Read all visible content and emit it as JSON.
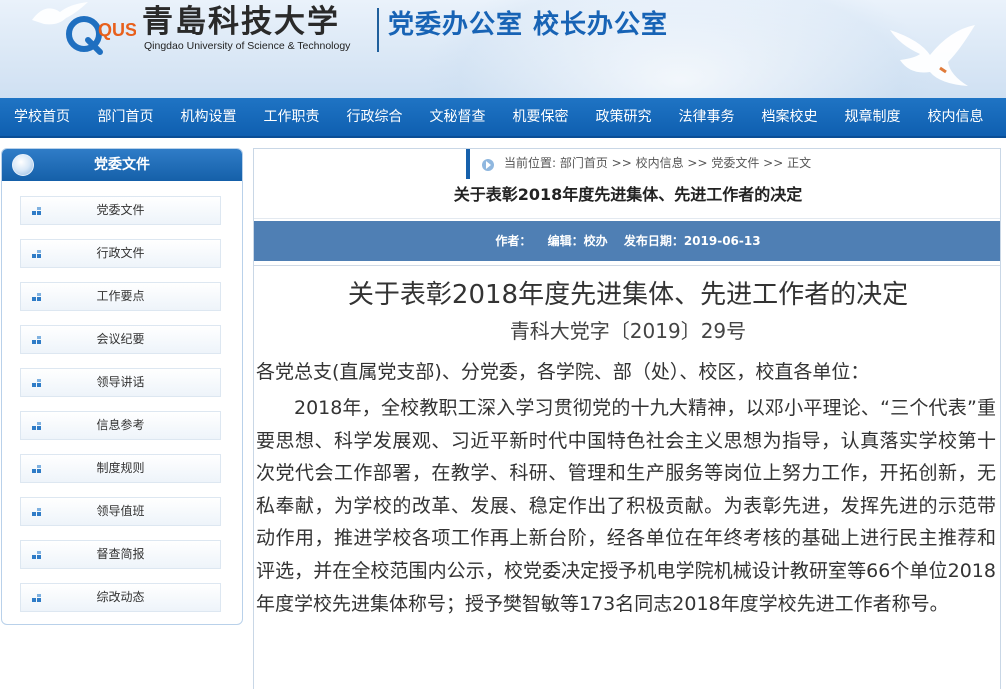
{
  "header": {
    "school_name_cn": "青島科技大学",
    "school_name_en": "Qingdao University of Science & Technology",
    "dept_title": "党委办公室  校长办公室",
    "logo_text": "QUST"
  },
  "nav": {
    "items": [
      "学校首页",
      "部门首页",
      "机构设置",
      "工作职责",
      "行政综合",
      "文秘督查",
      "机要保密",
      "政策研究",
      "法律事务",
      "档案校史",
      "规章制度",
      "校内信息"
    ]
  },
  "sidebar": {
    "title": "党委文件",
    "items": [
      "党委文件",
      "行政文件",
      "工作要点",
      "会议纪要",
      "领导讲话",
      "信息参考",
      "制度规则",
      "领导值班",
      "督查简报",
      "综改动态"
    ]
  },
  "breadcrumb": {
    "text": "当前位置: 部门首页 >> 校内信息 >> 党委文件 >> 正文"
  },
  "article": {
    "head_title": "关于表彰2018年度先进集体、先进工作者的决定",
    "meta": {
      "author_label": "作者：",
      "editor_label": "编辑：校办",
      "date_label": "发布日期：2019-06-13"
    },
    "title": "关于表彰2018年度先进集体、先进工作者的决定",
    "doc_number": "青科大党字〔2019〕29号",
    "salutation": "各党总支(直属党支部)、分党委，各学院、部（处）、校区，校直各单位：",
    "body": "2018年，全校教职工深入学习贯彻党的十九大精神，以邓小平理论、“三个代表”重要思想、科学发展观、习近平新时代中国特色社会主义思想为指导，认真落实学校第十次党代会工作部署，在教学、科研、管理和生产服务等岗位上努力工作，开拓创新，无私奉献，为学校的改革、发展、稳定作出了积极贡献。为表彰先进，发挥先进的示范带动作用，推进学校各项工作再上新台阶，经各单位在年终考核的基础上进行民主推荐和评选，并在全校范围内公示，校党委决定授予机电学院机械设计教研室等66个单位2018年度学校先进集体称号；授予樊智敏等173名同志2018年度学校先进工作者称号。"
  },
  "colors": {
    "nav_bg": "#1668b8",
    "dept_title": "#1763b5",
    "meta_bar": "#4f7fb4",
    "sidebar_head": "#1f6db8"
  }
}
